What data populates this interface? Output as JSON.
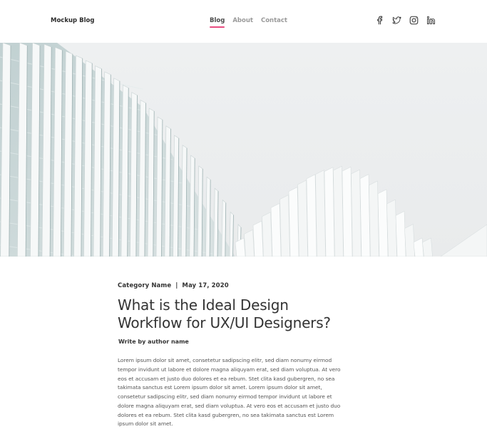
{
  "header": {
    "brand": "Mockup Blog",
    "nav": [
      {
        "label": "Blog",
        "active": true
      },
      {
        "label": "About",
        "active": false
      },
      {
        "label": "Contact",
        "active": false
      }
    ],
    "social_icons": [
      "facebook-icon",
      "twitter-icon",
      "instagram-icon",
      "linkedin-icon"
    ]
  },
  "hero": {
    "description": "architecture-photo"
  },
  "article": {
    "category": "Category Name",
    "separator": "|",
    "date": "May 17, 2020",
    "title": "What is the Ideal Design Workflow for UX/UI Designers?",
    "author": "Write by author name",
    "body": "Lorem ipsum dolor sit amet, consetetur sadipscing elitr, sed diam nonumy eirmod tempor invidunt ut labore et dolore magna aliquyam erat, sed diam voluptua. At vero eos et accusam et justo duo dolores et ea rebum. Stet clita kasd gubergren, no sea takimata sanctus est Lorem ipsum dolor sit amet. Lorem ipsum dolor sit amet, consetetur sadipscing elitr, sed diam nonumy eirmod tempor invidunt ut labore et dolore magna aliquyam erat, sed diam voluptua. At vero eos et accusam et justo duo dolores et ea rebum. Stet clita kasd gubergren, no sea takimata sanctus est Lorem ipsum dolor sit amet."
  },
  "colors": {
    "accent": "#e84c80",
    "text": "#333333",
    "muted": "#9a9a9a"
  }
}
